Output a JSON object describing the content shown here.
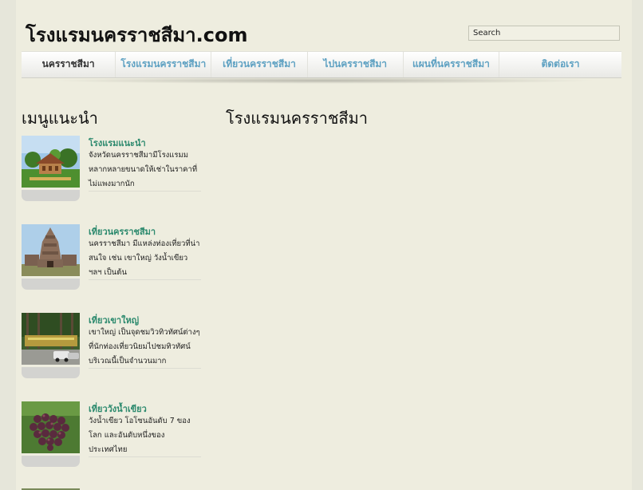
{
  "header": {
    "logo_text": "โรงแรมนครราชสีมา.com",
    "search_value": "Search"
  },
  "nav": {
    "items": [
      {
        "label": "นครราชสีมา",
        "active": true
      },
      {
        "label": "โรงแรมนครราชสีมา",
        "active": false
      },
      {
        "label": "เที่ยวนครราชสีมา",
        "active": false
      },
      {
        "label": "ไปนครราชสีมา",
        "active": false
      },
      {
        "label": "แผนที่นครราชสีมา",
        "active": false
      },
      {
        "label": "ติดต่อเรา",
        "active": false
      }
    ]
  },
  "sidebar": {
    "title": "เมนูแนะนำ",
    "cards": [
      {
        "title": "โรงแรมแนะนำ",
        "text": "จังหวัดนครราชสีมามีโรงแรมมหลากหลายขนาดให้เช่าในราคาที่ไม่แพงมากนัก"
      },
      {
        "title": "เที่ยวนครราชสีมา",
        "text": "นครราชสีมา มีแหล่งท่องเที่ยวที่น่าสนใจ เช่น เขาใหญ่ วังน้ำเขียว ฯลฯ เป็นต้น"
      },
      {
        "title": "เที่ยวเขาใหญ่",
        "text": "เขาใหญ่ เป็นจุดชมวิวทิวทัศน์ต่างๆ ที่นักท่องเที่ยวนิยมไปชมทิวทัศน์บริเวณนี้เป็นจำนวนมาก"
      },
      {
        "title": "เที่ยววังน้ำเขียว",
        "text": "วังน้ำเขียว โอโซนอันดับ 7 ของโลก และอันดับหนึ่งของประเทศไทย"
      }
    ]
  },
  "main": {
    "title": "โรงแรมนครราชสีมา"
  }
}
